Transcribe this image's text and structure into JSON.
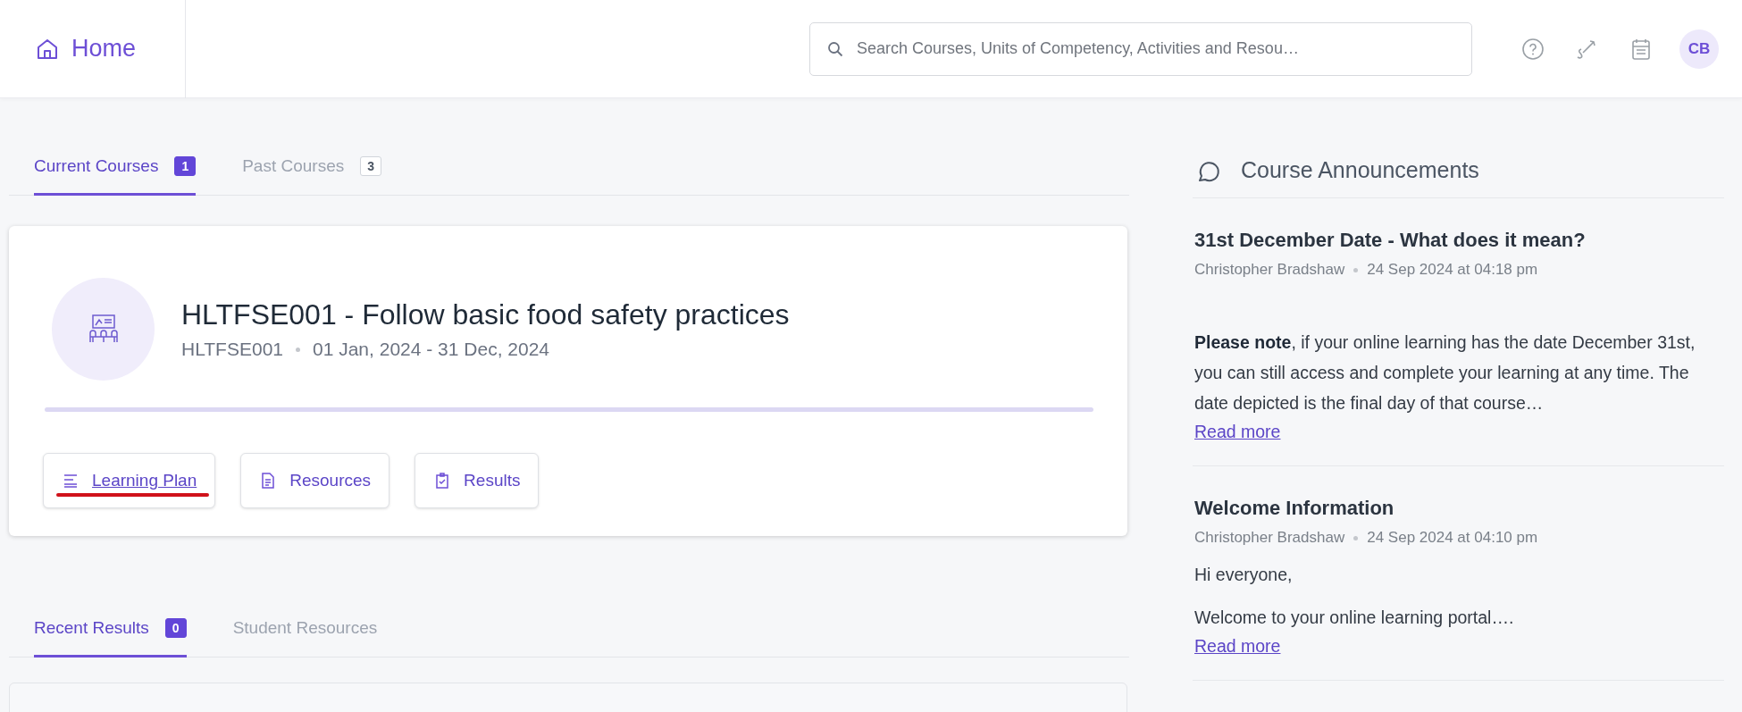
{
  "header": {
    "home": "Home",
    "search": {
      "placeholder": "Search Courses, Units of Competency, Activities and Resou…"
    },
    "avatar": "CB"
  },
  "course_tabs": [
    {
      "label": "Current Courses",
      "count": "1",
      "selected": true
    },
    {
      "label": "Past Courses",
      "count": "3",
      "selected": false
    }
  ],
  "course": {
    "title": "HLTFSE001 - Follow basic food safety practices",
    "code": "HLTFSE001",
    "dates": "01 Jan, 2024 - 31 Dec, 2024",
    "level": 1,
    "buttons": [
      {
        "kind": "plan",
        "label": "Learning Plan",
        "annotated": true
      },
      {
        "kind": "resources",
        "label": "Resources",
        "annotated": false
      },
      {
        "kind": "results",
        "label": "Results",
        "annotated": false
      }
    ]
  },
  "results_tabs": [
    {
      "label": "Recent Results",
      "count": "0",
      "selected": true
    },
    {
      "label": "Student Resources",
      "selected": false
    }
  ],
  "announcements": {
    "title": "Course Announcements",
    "items": [
      {
        "title": "31st December Date - What does it mean?",
        "author": "Christopher Bradshaw",
        "time": "24 Sep 2024 at 04:18 pm",
        "paragraphs": [
          "**Please note**, if your online learning has the date December 31st, you can still access and complete your learning at any time. The date depicted is the final day of that course…"
        ],
        "link": "Read more",
        "gap": true
      },
      {
        "title": "Welcome Information",
        "author": "Christopher Bradshaw",
        "time": "24 Sep 2024 at 04:10 pm",
        "paragraphs": [
          "Hi everyone,",
          "Welcome to your online learning portal…."
        ],
        "link": "Read more",
        "gap": false
      }
    ]
  }
}
